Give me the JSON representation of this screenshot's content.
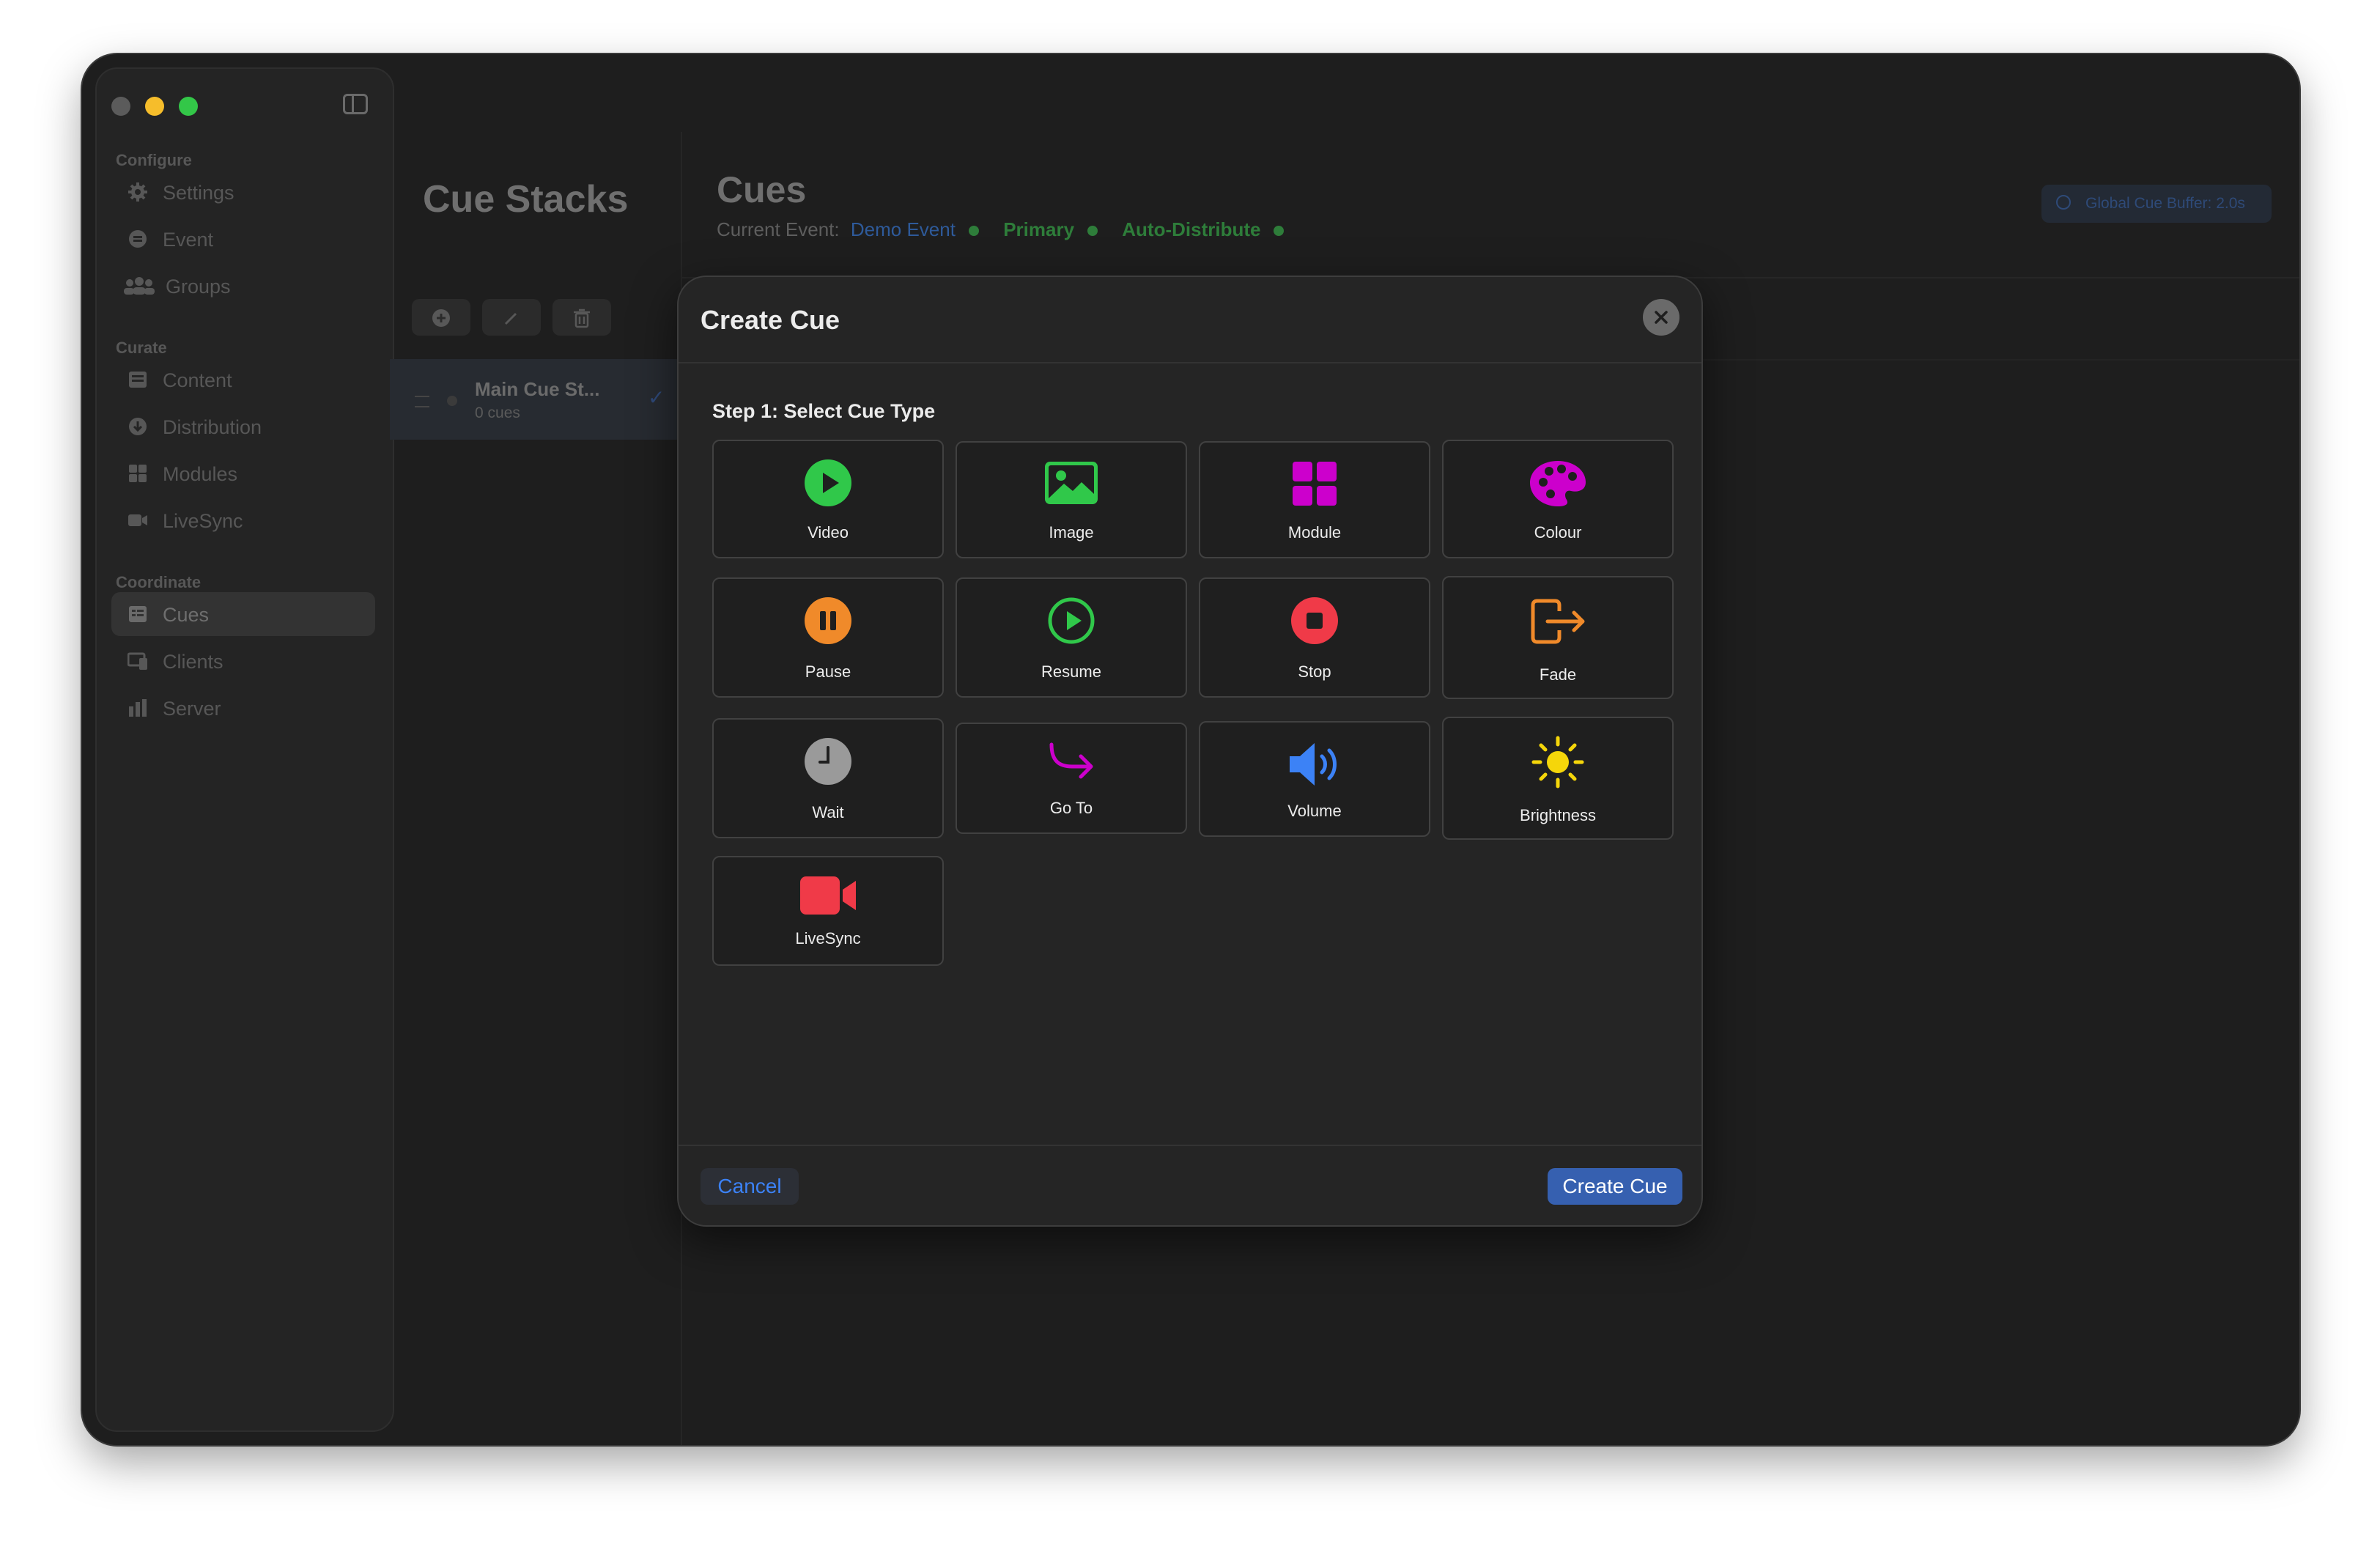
{
  "sidebar": {
    "sections": [
      {
        "title": "Configure",
        "items": [
          {
            "label": "Settings",
            "icon": "gear-icon"
          },
          {
            "label": "Event",
            "icon": "event-icon"
          },
          {
            "label": "Groups",
            "icon": "groups-icon"
          }
        ]
      },
      {
        "title": "Curate",
        "items": [
          {
            "label": "Content",
            "icon": "content-icon"
          },
          {
            "label": "Distribution",
            "icon": "distribution-icon"
          },
          {
            "label": "Modules",
            "icon": "modules-icon"
          },
          {
            "label": "LiveSync",
            "icon": "camera-icon"
          }
        ]
      },
      {
        "title": "Coordinate",
        "items": [
          {
            "label": "Cues",
            "icon": "cues-icon",
            "active": true
          },
          {
            "label": "Clients",
            "icon": "clients-icon"
          },
          {
            "label": "Server",
            "icon": "server-icon"
          }
        ]
      }
    ]
  },
  "stacks": {
    "title": "Cue Stacks",
    "items": [
      {
        "name": "Main Cue St...",
        "count": "0 cues",
        "selected": true
      }
    ]
  },
  "cues": {
    "title": "Cues",
    "event_label": "Current Event:",
    "event_name": "Demo Event",
    "role": "Primary",
    "distribution": "Auto-Distribute",
    "buffer": "Global Cue Buffer:  2.0s"
  },
  "modal": {
    "title": "Create Cue",
    "step": "Step 1: Select Cue Type",
    "cancel": "Cancel",
    "create": "Create Cue",
    "tiles": [
      {
        "label": "Video",
        "icon": "play-circle-icon",
        "color": "#30c84a"
      },
      {
        "label": "Image",
        "icon": "photo-icon",
        "color": "#30c84a"
      },
      {
        "label": "Module",
        "icon": "grid-icon",
        "color": "#cc00cc"
      },
      {
        "label": "Colour",
        "icon": "palette-icon",
        "color": "#cc00cc"
      },
      {
        "label": "Pause",
        "icon": "pause-circle-icon",
        "color": "#f08a2a"
      },
      {
        "label": "Resume",
        "icon": "play-outline-icon",
        "color": "#30c84a"
      },
      {
        "label": "Stop",
        "icon": "stop-circle-icon",
        "color": "#f03a48"
      },
      {
        "label": "Fade",
        "icon": "exit-icon",
        "color": "#f08a2a"
      },
      {
        "label": "Wait",
        "icon": "clock-icon",
        "color": "#9a9a9a"
      },
      {
        "label": "Go To",
        "icon": "arrow-turn-icon",
        "color": "#cc00cc"
      },
      {
        "label": "Volume",
        "icon": "speaker-icon",
        "color": "#3c82f6"
      },
      {
        "label": "Brightness",
        "icon": "sun-icon",
        "color": "#f5d60a"
      },
      {
        "label": "LiveSync",
        "icon": "video-camera-icon",
        "color": "#f03a48"
      }
    ]
  }
}
